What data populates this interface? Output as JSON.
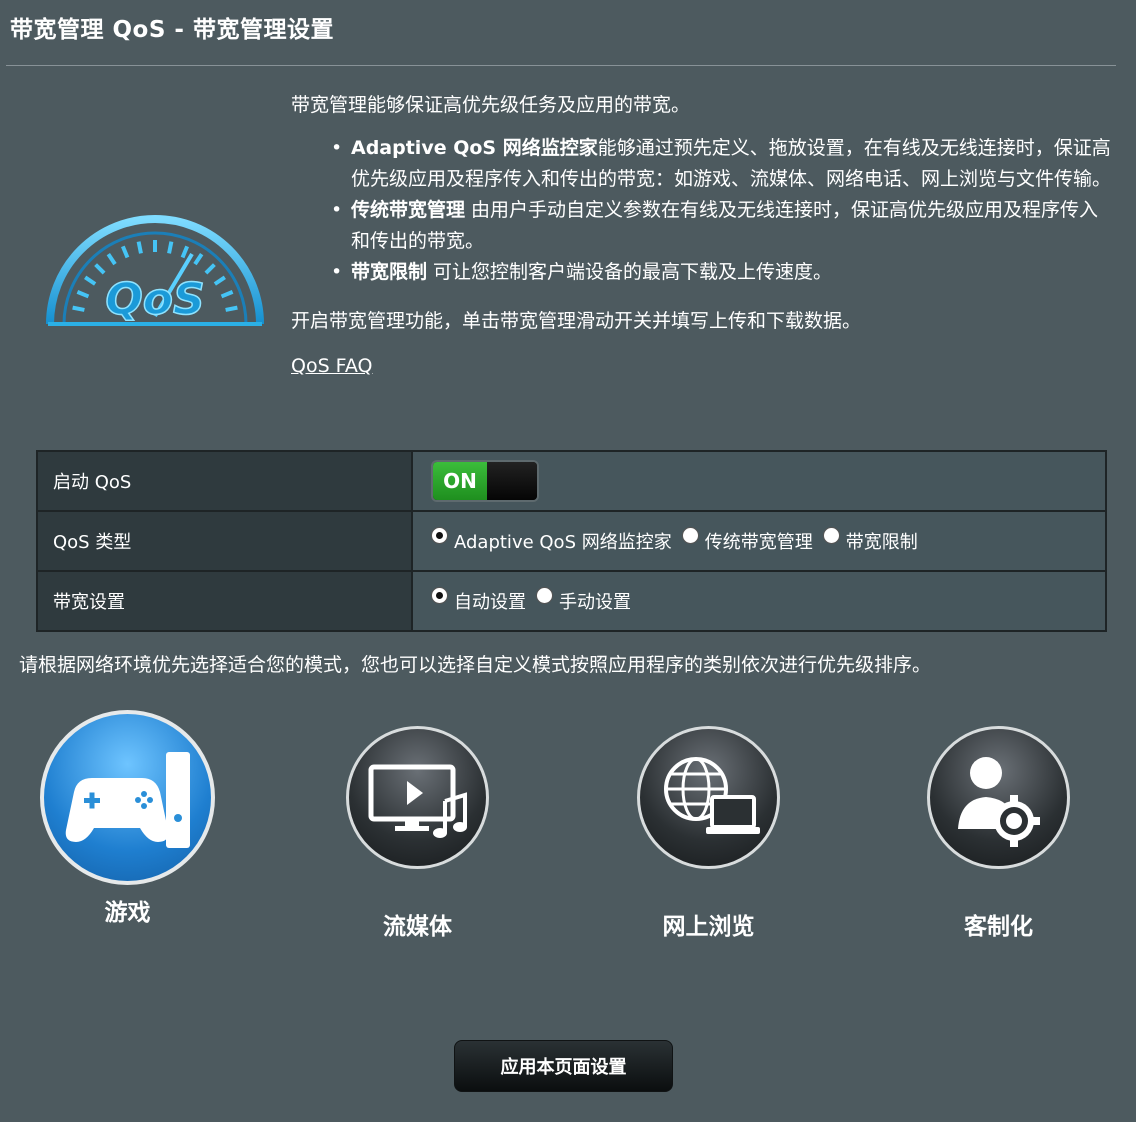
{
  "header": {
    "title": "带宽管理 QoS - 带宽管理设置"
  },
  "intro": {
    "summary": "带宽管理能够保证高优先级任务及应用的带宽。",
    "bullets": [
      {
        "title": "Adaptive QoS 网络监控家",
        "text": "能够通过预先定义、拖放设置，在有线及无线连接时，保证高优先级应用及程序传入和传出的带宽：如游戏、流媒体、网络电话、网上浏览与文件传输。"
      },
      {
        "title": "传统带宽管理",
        "text": " 由用户手动自定义参数在有线及无线连接时，保证高优先级应用及程序传入和传出的带宽。"
      },
      {
        "title": "带宽限制",
        "text": " 可让您控制客户端设备的最高下载及上传速度。"
      }
    ],
    "enable_text": "开启带宽管理功能，单击带宽管理滑动开关并填写上传和下载数据。",
    "faq_link": "QoS FAQ"
  },
  "logo": {
    "text": "QoS"
  },
  "settings": {
    "enable_label": "启动 QoS",
    "toggle_text": "ON",
    "type_label": "QoS 类型",
    "type_options": [
      "Adaptive QoS 网络监控家",
      "传统带宽管理",
      "带宽限制"
    ],
    "type_selected": 0,
    "bandwidth_label": "带宽设置",
    "bandwidth_options": [
      "自动设置",
      "手动设置"
    ],
    "bandwidth_selected": 0
  },
  "mode_hint": "请根据网络环境优先选择适合您的模式，您也可以选择自定义模式按照应用程序的类别依次进行优先级排序。",
  "modes": [
    {
      "label": "游戏",
      "icon": "gamepad-icon",
      "selected": true
    },
    {
      "label": "流媒体",
      "icon": "streaming-icon",
      "selected": false
    },
    {
      "label": "网上浏览",
      "icon": "web-browsing-icon",
      "selected": false
    },
    {
      "label": "客制化",
      "icon": "customize-icon",
      "selected": false
    }
  ],
  "apply_button": "应用本页面设置",
  "colors": {
    "background": "#4d5a5f",
    "toggle_on": "#2ea82e",
    "logo_blue": "#2bb0e6",
    "selected_mode": "#2a8fd8"
  }
}
